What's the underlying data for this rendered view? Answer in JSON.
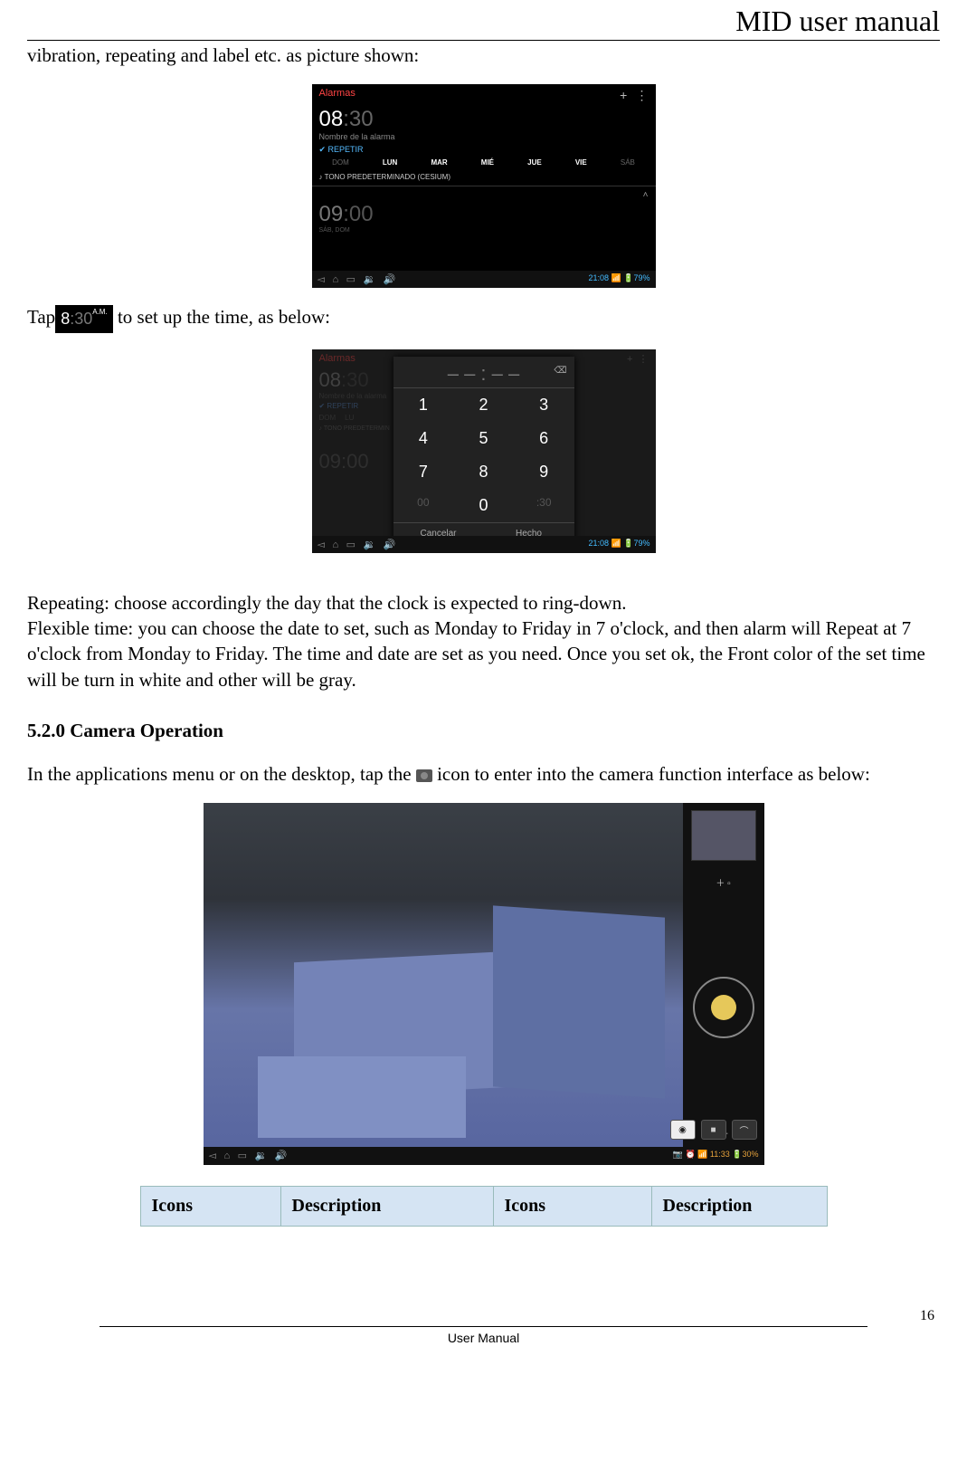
{
  "header": {
    "title": "MID user manual"
  },
  "body": {
    "line1": "vibration, repeating and label etc. as picture shown:",
    "tap_prefix": " Tap",
    "tap_suffix": " to set up the time, as below:",
    "repeating": "Repeating: choose accordingly the day that the clock is expected to ring-down.",
    "flexible": "Flexible time: you can choose the date to set, such as Monday to Friday in 7 o'clock, and then alarm will Repeat at 7 o'clock from Monday to Friday. The time and date are set as you need. Once you set ok, the Front color of the set time will be turn in white and other will be gray.",
    "section_520": "5.2.0 Camera Operation",
    "camera_intro_a": "In the applications menu or on the desktop, tap the ",
    "camera_intro_b": " icon to enter into the camera function interface as below:"
  },
  "inline_clock": {
    "h": "8",
    "m": ":30",
    "ampm": "A.M."
  },
  "ss1": {
    "title": "Alarmas",
    "plus": "+",
    "menu": "⋮",
    "hour": "08",
    "minute": ":30",
    "name_label": "Nombre de la alarma",
    "repetir": "✔ REPETIR",
    "days": [
      "DOM",
      "LUN",
      "MAR",
      "MIÉ",
      "JUE",
      "VIE",
      "SÁB"
    ],
    "tone": "♪  TONO PREDETERMINADO (CESIUM)",
    "collapse": "˄",
    "alarm2_h": "09",
    "alarm2_m": ":00",
    "alarm2_sub": "SÁB, DOM",
    "status_time": "21:08",
    "status_batt": "79%"
  },
  "ss2": {
    "title": "Alarmas",
    "display": "– – : – –",
    "del": "⌫",
    "keys": [
      "1",
      "2",
      "3",
      "4",
      "5",
      "6",
      "7",
      "8",
      "9",
      "00",
      "0",
      ":30"
    ],
    "cancel": "Cancelar",
    "ok": "Hecho",
    "bg_hour": "08",
    "bg_min": ":30",
    "bg_name": "Nombre de la alarma",
    "bg_rep": "✔ REPETIR",
    "bg_days": [
      "DOM",
      "LU"
    ],
    "bg_tone": "♪  TONO PREDETERMIN",
    "bg_a2": "09:00",
    "status_time": "21:08",
    "status_batt": "79%"
  },
  "ss3": {
    "zoom_plus": "＋ ▫",
    "zoom_minus": "○ －  ▫",
    "mode_photo": "◉",
    "mode_video": "■",
    "mode_pano": "⌒",
    "status_time": "11:33",
    "status_batt": "30%"
  },
  "table": {
    "h1": "Icons",
    "h2": "Description",
    "h3": "Icons",
    "h4": "Description"
  },
  "footer": {
    "page": "16",
    "label": "User Manual"
  }
}
